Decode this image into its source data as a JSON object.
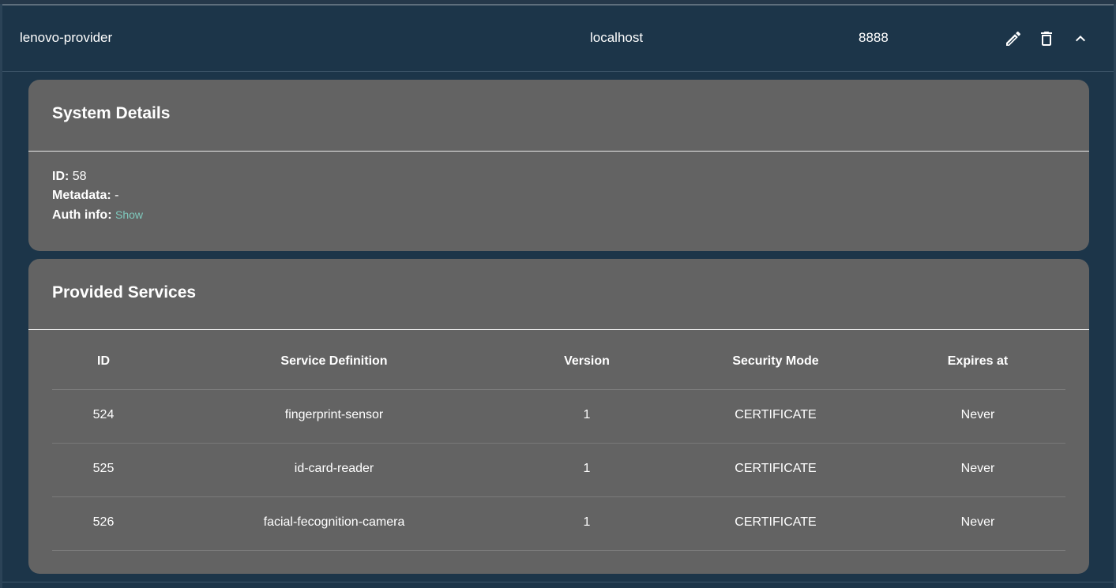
{
  "system": {
    "name": "lenovo-provider",
    "address": "localhost",
    "port": "8888"
  },
  "actions": {
    "edit_icon": "pencil-icon",
    "delete_icon": "trash-icon",
    "collapse_icon": "chevron-up-icon"
  },
  "system_details": {
    "title": "System Details",
    "id_label": "ID:",
    "id_value": "58",
    "metadata_label": "Metadata:",
    "metadata_value": "-",
    "auth_label": "Auth info:",
    "auth_link": "Show"
  },
  "provided_services": {
    "title": "Provided Services",
    "columns": [
      "ID",
      "Service Definition",
      "Version",
      "Security Mode",
      "Expires at"
    ],
    "rows": [
      {
        "id": "524",
        "definition": "fingerprint-sensor",
        "version": "1",
        "security": "CERTIFICATE",
        "expires": "Never"
      },
      {
        "id": "525",
        "definition": "id-card-reader",
        "version": "1",
        "security": "CERTIFICATE",
        "expires": "Never"
      },
      {
        "id": "526",
        "definition": "facial-fecognition-camera",
        "version": "1",
        "security": "CERTIFICATE",
        "expires": "Never"
      }
    ]
  },
  "colors": {
    "background": "#1c3549",
    "card": "#636363",
    "link": "#7fc9bd"
  }
}
